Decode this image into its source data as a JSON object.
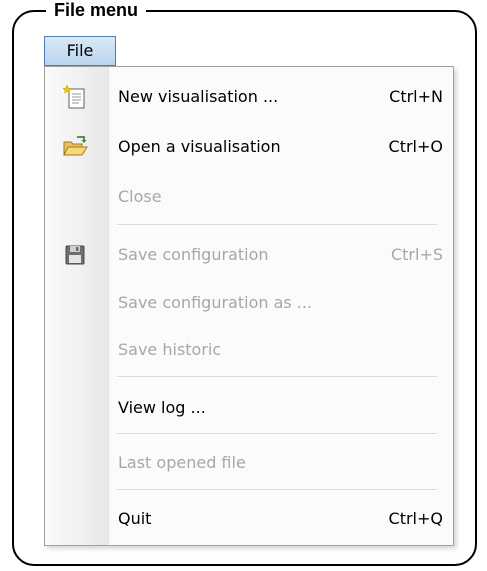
{
  "frame": {
    "title": "File menu"
  },
  "menubar": {
    "file_label": "File"
  },
  "menu": {
    "items": [
      {
        "label": "New visualisation ...",
        "shortcut": "Ctrl+N",
        "icon": "new-document-icon",
        "enabled": true
      },
      {
        "label": "Open a visualisation",
        "shortcut": "Ctrl+O",
        "icon": "open-folder-icon",
        "enabled": true
      },
      {
        "label": "Close",
        "shortcut": "",
        "icon": "",
        "enabled": false
      },
      {
        "label": "Save configuration",
        "shortcut": "Ctrl+S",
        "icon": "floppy-disk-icon",
        "enabled": false
      },
      {
        "label": "Save configuration as ...",
        "shortcut": "",
        "icon": "",
        "enabled": false
      },
      {
        "label": "Save historic",
        "shortcut": "",
        "icon": "",
        "enabled": false
      },
      {
        "label": "View log ...",
        "shortcut": "",
        "icon": "",
        "enabled": true
      },
      {
        "label": "Last opened file",
        "shortcut": "",
        "icon": "",
        "enabled": false
      },
      {
        "label": "Quit",
        "shortcut": "Ctrl+Q",
        "icon": "",
        "enabled": true
      }
    ]
  },
  "colors": {
    "disabled_text": "#a7a7a7",
    "highlight": "#b9d4ef"
  }
}
